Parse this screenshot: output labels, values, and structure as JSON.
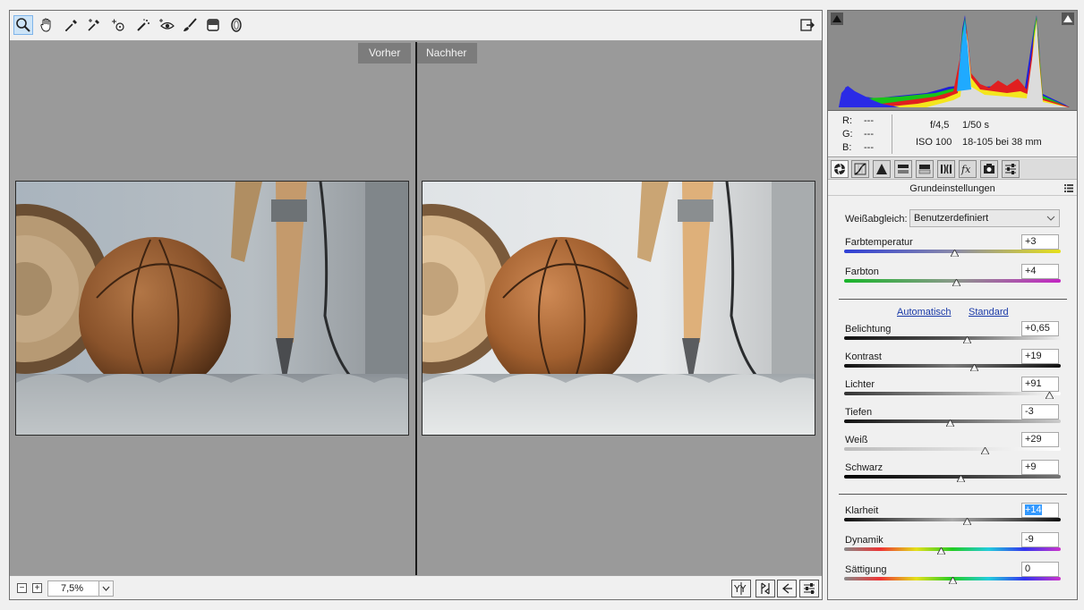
{
  "compare": {
    "before_label": "Vorher",
    "after_label": "Nachher"
  },
  "zoom": {
    "value": "7,5%",
    "minus": "−",
    "plus": "+"
  },
  "readout": {
    "r_label": "R:",
    "g_label": "G:",
    "b_label": "B:",
    "r_value": "---",
    "g_value": "---",
    "b_value": "---",
    "aperture": "f/4,5",
    "shutter": "1/50 s",
    "iso": "ISO 100",
    "lens": "18-105 bei 38 mm"
  },
  "panel": {
    "section_title": "Grundeinstellungen",
    "white_balance_label": "Weißabgleich:",
    "white_balance_value": "Benutzerdefiniert",
    "auto_link": "Automatisch",
    "default_link": "Standard",
    "sliders": [
      {
        "label": "Farbtemperatur",
        "value": "+3",
        "level": 0.51
      },
      {
        "label": "Farbton",
        "value": "+4",
        "level": 0.52
      },
      {
        "label": "Belichtung",
        "value": "+0,65",
        "level": 0.57
      },
      {
        "label": "Kontrast",
        "value": "+19",
        "level": 0.6
      },
      {
        "label": "Lichter",
        "value": "+91",
        "level": 0.95
      },
      {
        "label": "Tiefen",
        "value": "-3",
        "level": 0.49
      },
      {
        "label": "Weiß",
        "value": "+29",
        "level": 0.65
      },
      {
        "label": "Schwarz",
        "value": "+9",
        "level": 0.54
      },
      {
        "label": "Klarheit",
        "value": "+14",
        "level": 0.57
      },
      {
        "label": "Dynamik",
        "value": "-9",
        "level": 0.45
      },
      {
        "label": "Sättigung",
        "value": "0",
        "level": 0.5
      }
    ]
  },
  "icons": {
    "toolbar": [
      "zoom-tool-icon",
      "hand-tool-icon",
      "white-balance-tool-icon",
      "color-sampler-icon",
      "target-adjustment-icon",
      "spot-removal-icon",
      "red-eye-icon",
      "adjustment-brush-icon",
      "graduated-filter-icon",
      "radial-filter-icon",
      "export-icon"
    ],
    "tabs": [
      "basic-tab-icon",
      "tone-curve-tab-icon",
      "detail-tab-icon",
      "hsl-tab-icon",
      "split-toning-tab-icon",
      "lens-corrections-tab-icon",
      "effects-tab-icon",
      "camera-calibration-tab-icon",
      "presets-tab-icon"
    ]
  },
  "colors": {
    "panel_bg": "#f0f0f0",
    "preview_bg": "#9a9a9a",
    "link": "#1a3aa8",
    "selection": "#3399ff"
  }
}
